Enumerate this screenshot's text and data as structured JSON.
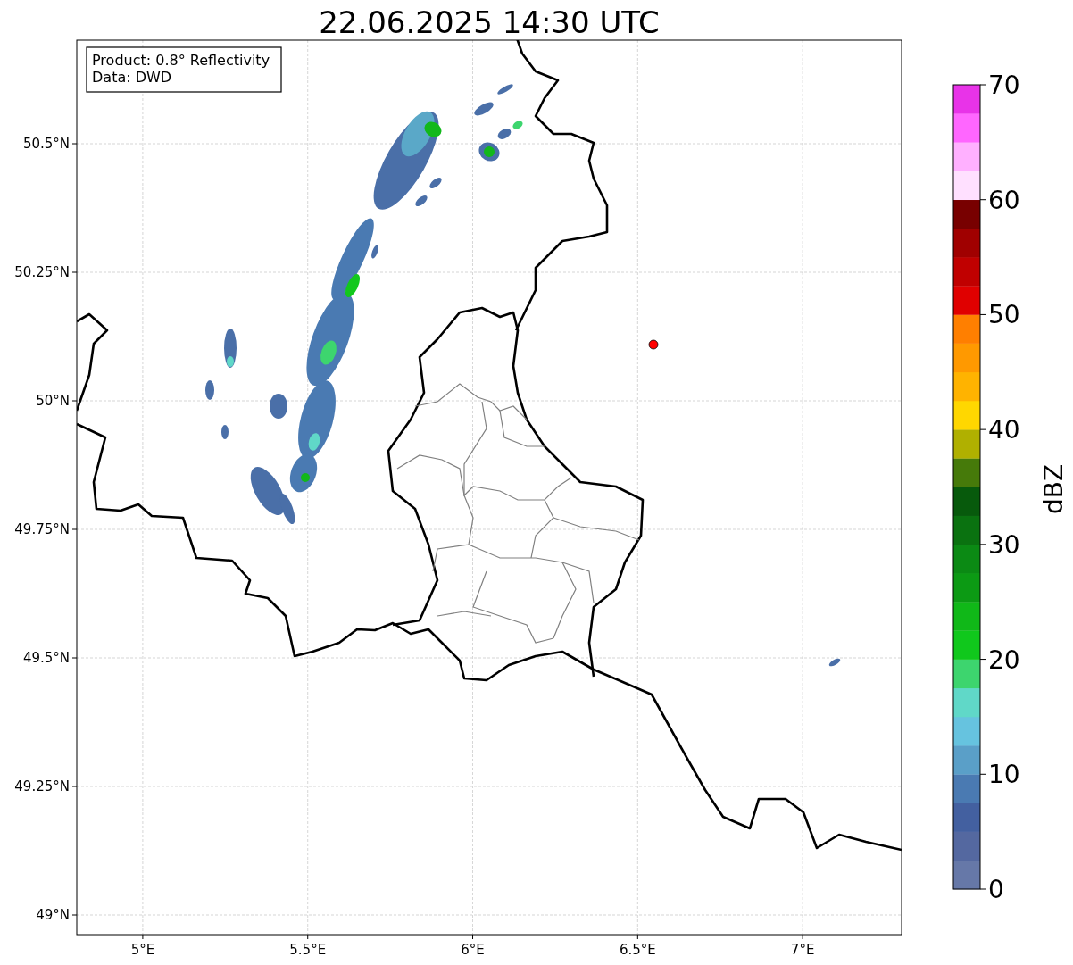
{
  "title": "22.06.2025 14:30 UTC",
  "legend": [
    "Product: 0.8° Reflectivity",
    "Data: DWD"
  ],
  "map": {
    "x_ticks": [
      "5°E",
      "5.5°E",
      "6°E",
      "6.5°E",
      "7°E"
    ],
    "y_ticks": [
      "50.5°N",
      "50.25°N",
      "50°N",
      "49.75°N",
      "49.5°N",
      "49.25°N",
      "49°N"
    ]
  },
  "colorbar": {
    "label": "dBZ",
    "ticks": [
      "70",
      "60",
      "50",
      "40",
      "30",
      "20",
      "10",
      "0"
    ],
    "bins": [
      {
        "color": "#6678a8"
      },
      {
        "color": "#5468a0"
      },
      {
        "color": "#4360a0"
      },
      {
        "color": "#4a7ab2"
      },
      {
        "color": "#5a9fc8"
      },
      {
        "color": "#66c3df"
      },
      {
        "color": "#60d8c8"
      },
      {
        "color": "#3dd56e"
      },
      {
        "color": "#10c81c"
      },
      {
        "color": "#10b818"
      },
      {
        "color": "#0c9a14"
      },
      {
        "color": "#0b8a14"
      },
      {
        "color": "#0a7210"
      },
      {
        "color": "#075a0c"
      },
      {
        "color": "#467a0a"
      },
      {
        "color": "#b0b000"
      },
      {
        "color": "#ffd700"
      },
      {
        "color": "#ffb300"
      },
      {
        "color": "#ff9900"
      },
      {
        "color": "#ff7f00"
      },
      {
        "color": "#e00000"
      },
      {
        "color": "#c00000"
      },
      {
        "color": "#a00000"
      },
      {
        "color": "#780000"
      },
      {
        "color": "#ffe0ff"
      },
      {
        "color": "#ffb0ff"
      },
      {
        "color": "#ff66ff"
      },
      {
        "color": "#e833e8"
      }
    ]
  }
}
